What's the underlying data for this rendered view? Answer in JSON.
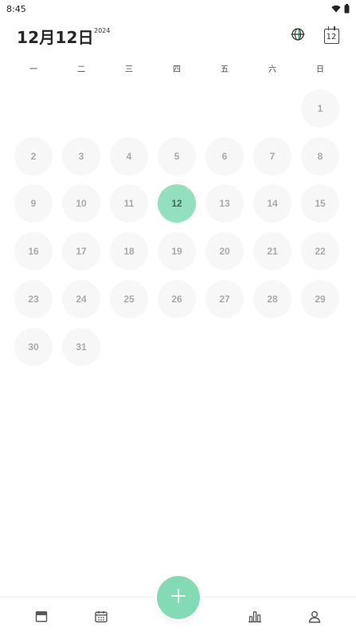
{
  "status_bar": {
    "time": "8:45",
    "icons": [
      "wifi-icon",
      "battery-icon"
    ]
  },
  "header": {
    "date_title": "12月12日",
    "year": "2024",
    "theme_icon": "globe-icon",
    "today_icon_label": "12"
  },
  "weekdays": [
    "一",
    "二",
    "三",
    "四",
    "五",
    "六",
    "日"
  ],
  "calendar": {
    "leading_blanks": 6,
    "days": [
      "1",
      "2",
      "3",
      "4",
      "5",
      "6",
      "7",
      "8",
      "9",
      "10",
      "11",
      "12",
      "13",
      "14",
      "15",
      "16",
      "17",
      "18",
      "19",
      "20",
      "21",
      "22",
      "23",
      "24",
      "25",
      "26",
      "27",
      "28",
      "29",
      "30",
      "31"
    ],
    "selected_day": "12",
    "colors": {
      "selected_bg": "#92e0be",
      "day_bg": "#f7f7f7",
      "day_text": "#aaaaaa"
    }
  },
  "bottom_nav": {
    "items": [
      "box-icon",
      "calendar-icon",
      "bar-chart-icon",
      "person-icon"
    ],
    "fab_icon": "plus-icon",
    "fab_color": "#83dbb5"
  }
}
